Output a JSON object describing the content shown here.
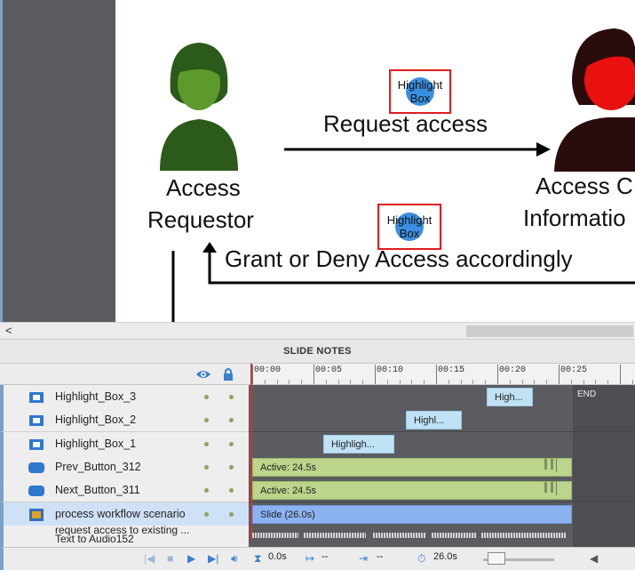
{
  "slide": {
    "access_requestor_line1": "Access",
    "access_requestor_line2": "Requestor",
    "request_access": "Request access",
    "grant_deny": "Grant or Deny Access accordingly",
    "owner_line1": "Access C",
    "owner_line2": "Informatio",
    "highlight_box_label_line1": "Highlight",
    "highlight_box_label_line2": "Box"
  },
  "scrollbar": {
    "left_arrow": "<"
  },
  "timeline": {
    "panel_title": "SLIDE NOTES",
    "ruler_labels": [
      "00:00",
      "00:05",
      "00:10",
      "00:15",
      "00:20",
      "00:25"
    ],
    "end_label": "END",
    "layers": [
      {
        "name": "Highlight_Box_3",
        "clip_label": "High...",
        "kind": "box"
      },
      {
        "name": "Highlight_Box_2",
        "clip_label": "Highl...",
        "kind": "box"
      },
      {
        "name": "Highlight_Box_1",
        "clip_label": "Highligh...",
        "kind": "box"
      },
      {
        "name": "Prev_Button_312",
        "clip_label": "Active: 24.5s",
        "kind": "button"
      },
      {
        "name": "Next_Button_311",
        "clip_label": "Active: 24.5s",
        "kind": "button"
      },
      {
        "name": "process workflow scenario",
        "clip_label": "Slide (26.0s)",
        "kind": "slide"
      }
    ],
    "audio_label_line1": "request access to existing ...",
    "audio_label_line2": "Text to Audio152"
  },
  "toolbar": {
    "current_time": "0.0s",
    "start_time": "--",
    "end_time": "--",
    "duration": "26.0s"
  },
  "colors": {
    "accent_blue": "#3b7fcf",
    "highlight_red": "#e01c1c",
    "active_clip_green": "#bcd58a",
    "slide_clip_blue": "#8cb3f1",
    "requestor_figure": "#4e8a2a",
    "owner_figure": "#e01010"
  }
}
